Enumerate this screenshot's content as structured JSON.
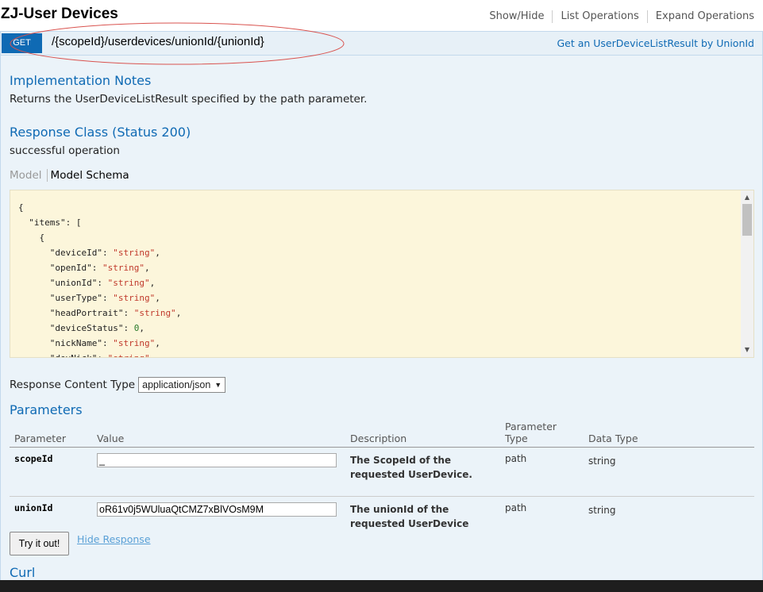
{
  "resource": {
    "title": "ZJ-User Devices",
    "links": [
      "Show/Hide",
      "List Operations",
      "Expand Operations"
    ]
  },
  "operation": {
    "method": "GET",
    "path": "/{scopeId}/userdevices/unionId/{unionId}",
    "summary": "Get an UserDeviceListResult by UnionId",
    "annotation_color": "#d9534f",
    "method_color": "#0f6ab4"
  },
  "implementation": {
    "heading": "Implementation Notes",
    "text": "Returns the UserDeviceListResult specified by the path parameter."
  },
  "response_class": {
    "heading": "Response Class (Status 200)",
    "text": "successful operation"
  },
  "model_tabs": {
    "model": "Model",
    "schema": "Model Schema"
  },
  "schema_lines": [
    {
      "indent": 0,
      "text": "{"
    },
    {
      "indent": 1,
      "key": "\"items\"",
      "rest": ": ["
    },
    {
      "indent": 2,
      "text": "{"
    },
    {
      "indent": 3,
      "key": "\"deviceId\"",
      "str": "\"string\"",
      "tail": ","
    },
    {
      "indent": 3,
      "key": "\"openId\"",
      "str": "\"string\"",
      "tail": ","
    },
    {
      "indent": 3,
      "key": "\"unionId\"",
      "str": "\"string\"",
      "tail": ","
    },
    {
      "indent": 3,
      "key": "\"userType\"",
      "str": "\"string\"",
      "tail": ","
    },
    {
      "indent": 3,
      "key": "\"headPortrait\"",
      "str": "\"string\"",
      "tail": ","
    },
    {
      "indent": 3,
      "key": "\"deviceStatus\"",
      "num": "0",
      "tail": ","
    },
    {
      "indent": 3,
      "key": "\"nickName\"",
      "str": "\"string\"",
      "tail": ","
    },
    {
      "indent": 3,
      "key": "\"devNick\"",
      "str": "\"string\"",
      "tail": ","
    }
  ],
  "response_content_type": {
    "label": "Response Content Type",
    "selected": "application/json"
  },
  "parameters": {
    "heading": "Parameters",
    "columns": [
      "Parameter",
      "Value",
      "Description",
      "Parameter Type",
      "Data Type"
    ],
    "rows": [
      {
        "name": "scopeId",
        "value": "_",
        "description": "The ScopeId of the requested UserDevice.",
        "param_type": "path",
        "data_type": "string"
      },
      {
        "name": "unionId",
        "value": "oR61v0j5WUluaQtCMZ7xBlVOsM9M",
        "description": "The unionId of the requested UserDevice",
        "param_type": "path",
        "data_type": "string"
      }
    ]
  },
  "actions": {
    "try_label": "Try it out!",
    "hide_label": "Hide Response"
  },
  "curl": {
    "heading": "Curl"
  }
}
